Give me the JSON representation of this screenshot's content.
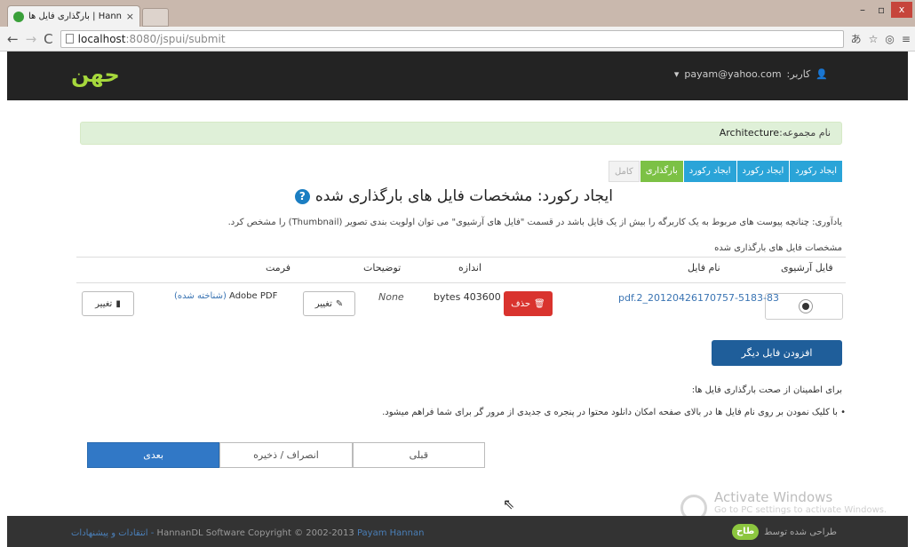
{
  "browser": {
    "tab_title": "بارگذاری فایل ها | HannanDL",
    "tab_close": "×",
    "url_host": "localhost",
    "url_rest": ":8080/jspui/submit",
    "win_min": "–",
    "win_max": "▫",
    "win_close": "x"
  },
  "header": {
    "logo_text": "ﺣﻬﻦ",
    "user_label": "کاربر:",
    "user_email": "payam@yahoo.com",
    "dropdown": "▾"
  },
  "collection": {
    "label": "نام مجموعه:",
    "value": "Architecture"
  },
  "steps": [
    {
      "label": "ایجاد رکورد",
      "state": "done"
    },
    {
      "label": "ایجاد رکورد",
      "state": "done"
    },
    {
      "label": "ایجاد رکورد",
      "state": "done"
    },
    {
      "label": "بارگذاری",
      "state": "current"
    },
    {
      "label": "کامل",
      "state": "disabled"
    }
  ],
  "page_title": "ایجاد رکورد: مشخصات فایل های بارگذاری شده",
  "hint": "یادآوری: چنانچه پیوست های مربوط به یک کاربرگه را بیش از یک فایل باشد در قسمت \"فایل های آرشیوی\" می توان اولویت بندی تصویر (Thumbnail) را مشخص کرد.",
  "subhead": "مشخصات فایل های بارگذاری شده",
  "table": {
    "headers": {
      "archive": "فایل آرشیوی",
      "filename": "نام فایل",
      "size": "اندازه",
      "description": "توضیحات",
      "format": "فرمت"
    },
    "row": {
      "filename": "pdf.2_20120426170757-5183-83",
      "delete_label": "حذف",
      "size": "bytes 403600",
      "description": "None",
      "change_label": "تغییر",
      "format": "Adobe PDF",
      "format_status": "(شناخته شده)",
      "change_label_2": "تغییر"
    }
  },
  "add_file_label": "افزودن فایل دیگر",
  "notes": {
    "title": "برای اطمینان از صحت بارگذاری فایل ها:",
    "item": "با کلیک نمودن بر روی نام فایل ها در بالای صفحه امکان دانلود محتوا در پنجره ی جدیدی از مرور گر برای شما فراهم میشود."
  },
  "nav": {
    "prev": "قبلی",
    "cancel": "انصراف / ذخیره",
    "next": "بعدی"
  },
  "watermark": {
    "title": "Activate Windows",
    "subtitle": "Go to PC settings to activate Windows."
  },
  "footer": {
    "left_plain": "HannanDL Software Copyright © 2002-2013",
    "left_link": "Payam Hannan",
    "left_feedback": "انتقادات و پیشنهادات -",
    "designed_by": "طراحی شده توسط",
    "mini_logo": "ﻃﺎﺡ"
  }
}
